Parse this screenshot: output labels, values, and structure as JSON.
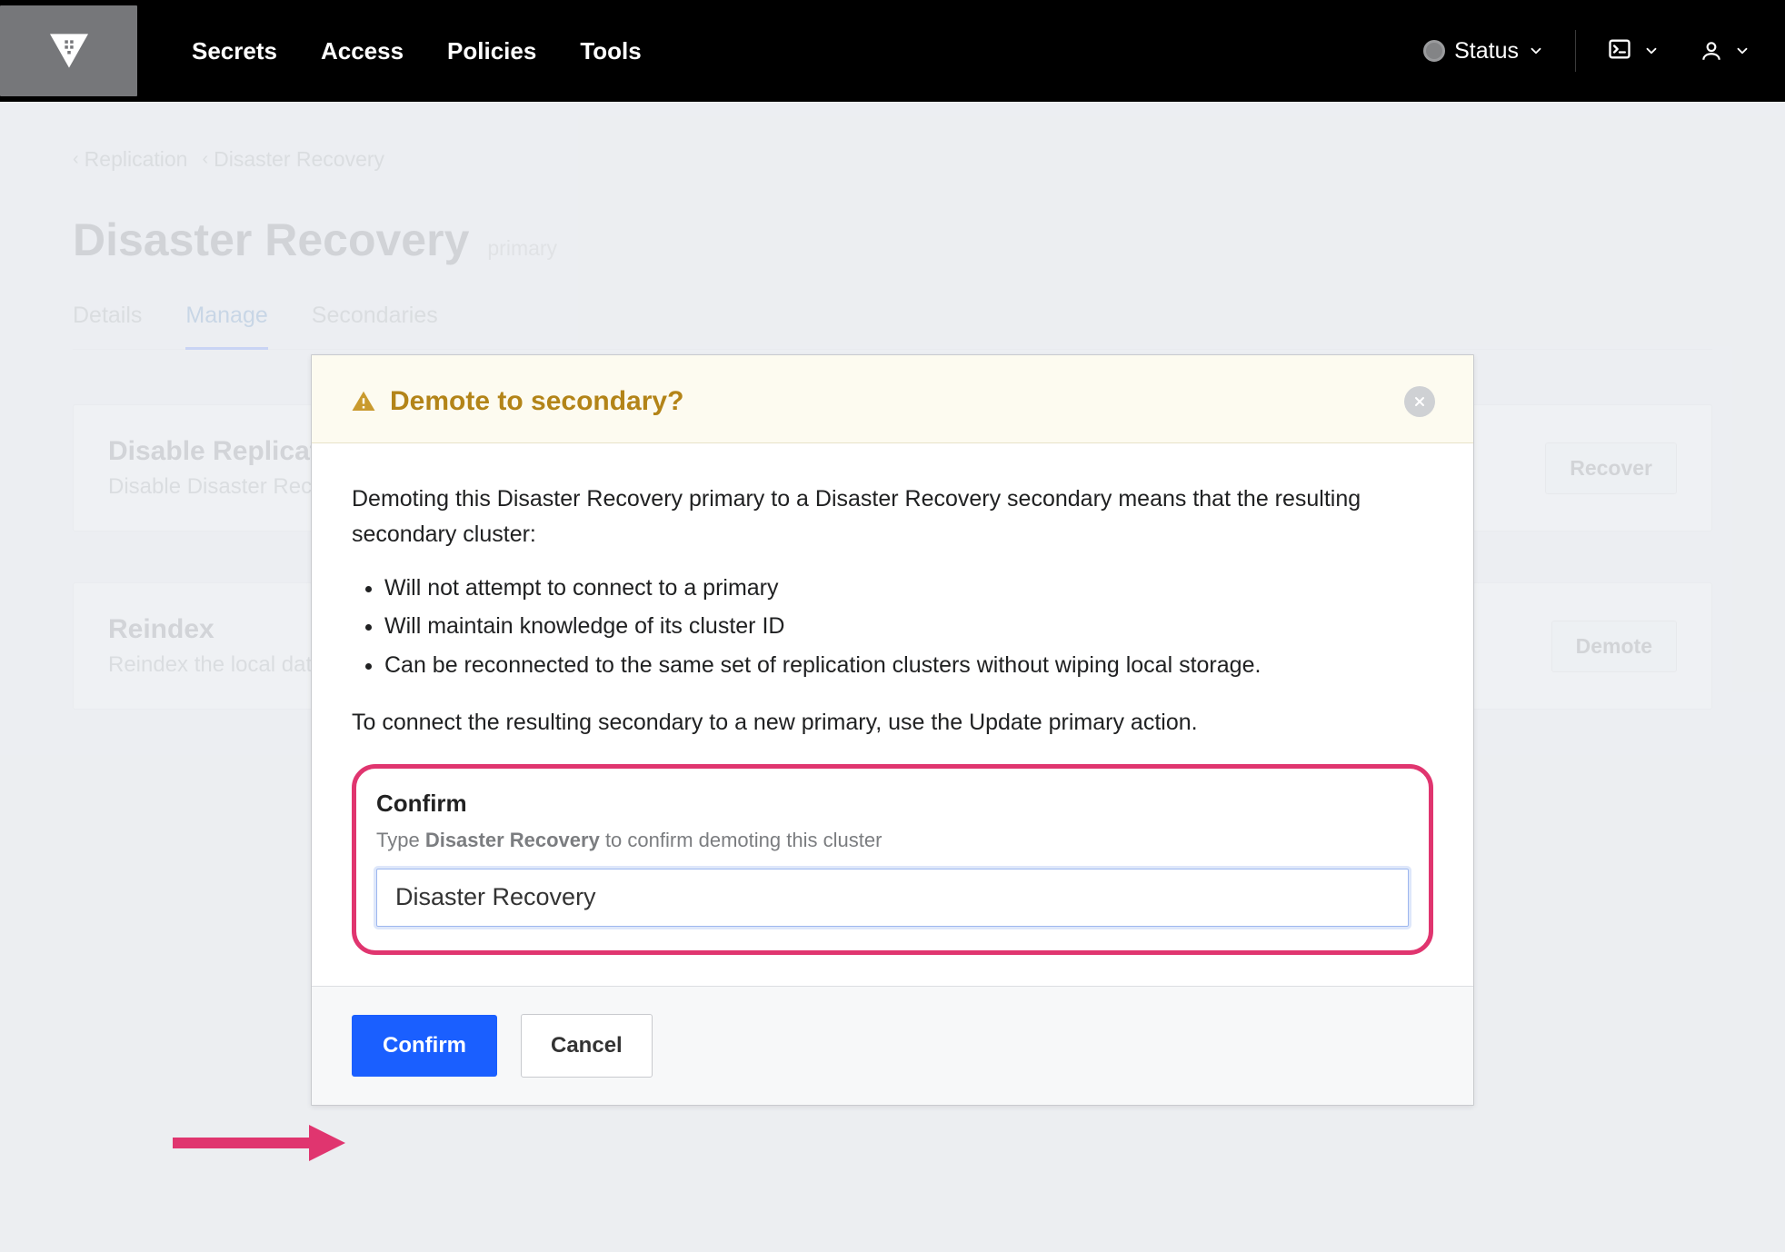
{
  "nav": {
    "items": [
      "Secrets",
      "Access",
      "Policies",
      "Tools"
    ],
    "status_label": "Status"
  },
  "breadcrumbs": [
    "Replication",
    "Disaster Recovery"
  ],
  "page": {
    "title": "Disaster Recovery",
    "role": "primary"
  },
  "tabs": [
    "Details",
    "Manage",
    "Secondaries"
  ],
  "cards": [
    {
      "title": "Disable Replication",
      "desc": "Disable Disaster Recovery Replication entirely on the cluster.",
      "button": "Recover"
    },
    {
      "title": "Reindex",
      "desc": "Reindex the local data storage.",
      "button": "Demote"
    }
  ],
  "modal": {
    "title": "Demote to secondary?",
    "intro": "Demoting this Disaster Recovery primary to a Disaster Recovery secondary means that the resulting secondary cluster:",
    "bullets": [
      "Will not attempt to connect to a primary",
      "Will maintain knowledge of its cluster ID",
      "Can be reconnected to the same set of replication clusters without wiping local storage."
    ],
    "outro": "To connect the resulting secondary to a new primary, use the Update primary action.",
    "confirm_label": "Confirm",
    "confirm_hint_prefix": "Type ",
    "confirm_hint_bold": "Disaster Recovery",
    "confirm_hint_suffix": " to confirm demoting this cluster",
    "input_value": "Disaster Recovery",
    "confirm_button": "Confirm",
    "cancel_button": "Cancel"
  }
}
